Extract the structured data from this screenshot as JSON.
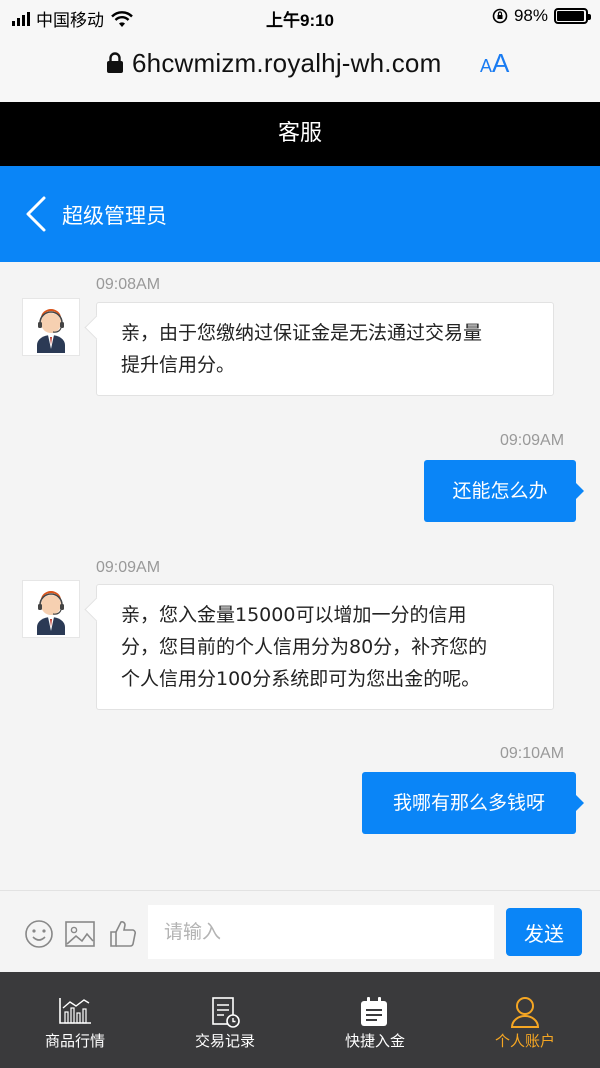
{
  "status_bar": {
    "carrier": "中国移动",
    "time": "上午9:10",
    "battery_text": "98%",
    "battery_level": 0.98
  },
  "browser": {
    "url": "6hcwmizm.royalhj-wh.com",
    "text_size_label_small": "A",
    "text_size_label_large": "A"
  },
  "page_title": "客服",
  "chat_header": {
    "contact_name": "超级管理员"
  },
  "messages": [
    {
      "direction": "in",
      "time": "09:08AM",
      "lines": [
        "亲，由于您缴纳过保证金是无法通过交易量",
        "提升信用分。"
      ]
    },
    {
      "direction": "out",
      "time": "09:09AM",
      "text": "还能怎么办"
    },
    {
      "direction": "in",
      "time": "09:09AM",
      "lines": [
        "亲，您入金量15000可以增加一分的信用",
        "分，您目前的个人信用分为80分，补齐您的",
        "个人信用分100分系统即可为您出金的呢。"
      ]
    },
    {
      "direction": "out",
      "time": "09:10AM",
      "text": "我哪有那么多钱呀"
    }
  ],
  "composer": {
    "placeholder": "请输入",
    "send_label": "发送",
    "tools": [
      "emoji-icon",
      "image-icon",
      "thumbs-up-icon"
    ]
  },
  "bottom_nav": [
    {
      "label": "商品行情",
      "icon": "chart-icon",
      "active": false
    },
    {
      "label": "交易记录",
      "icon": "record-icon",
      "active": false
    },
    {
      "label": "快捷入金",
      "icon": "deposit-icon",
      "active": false
    },
    {
      "label": "个人账户",
      "icon": "user-icon",
      "active": true
    }
  ],
  "colors": {
    "accent_blue": "#0a85f7",
    "title_bar": "#000000",
    "nav_bg": "#3a3a3c",
    "nav_active": "#f5a623"
  }
}
